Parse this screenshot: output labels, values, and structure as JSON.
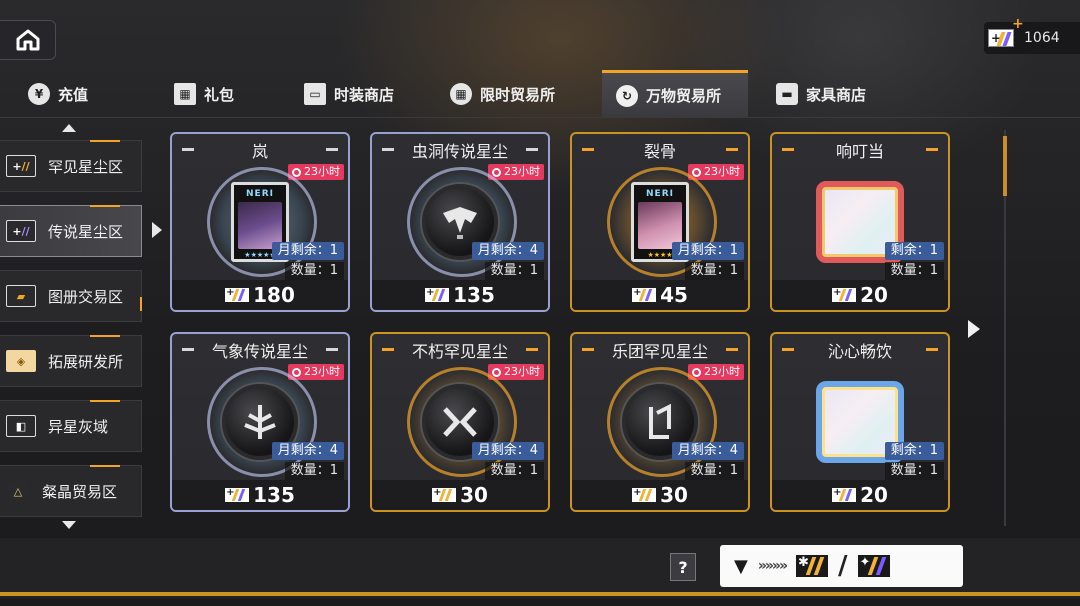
{
  "currency": {
    "amount": "1064",
    "icon": "holo-dust-icon"
  },
  "tabs": [
    {
      "label": "充值",
      "icon": "¥"
    },
    {
      "label": "礼包",
      "icon": "gift"
    },
    {
      "label": "时装商店",
      "icon": "card"
    },
    {
      "label": "限时贸易所",
      "icon": "grid"
    },
    {
      "label": "万物贸易所",
      "icon": "cycle",
      "active": true
    },
    {
      "label": "家具商店",
      "icon": "sofa"
    }
  ],
  "sidebar": {
    "items": [
      {
        "label": "罕见星尘区"
      },
      {
        "label": "传说星尘区",
        "active": true
      },
      {
        "label": "图册交易区"
      },
      {
        "label": "拓展研发所"
      },
      {
        "label": "异星灰域"
      },
      {
        "label": "粲晶贸易区"
      }
    ]
  },
  "cards": [
    {
      "title": "岚",
      "timer": "23小时",
      "remain": "月剩余：1",
      "qty": "数量：1",
      "price": "180",
      "style": "holo",
      "item": "portrait-dark"
    },
    {
      "title": "虫洞传说星尘",
      "timer": "23小时",
      "remain": "月剩余：4",
      "qty": "数量：1",
      "price": "135",
      "style": "holo",
      "item": "dust"
    },
    {
      "title": "裂骨",
      "timer": "23小时",
      "remain": "月剩余：1",
      "qty": "数量：1",
      "price": "45",
      "style": "gold",
      "item": "portrait-pink"
    },
    {
      "title": "响叮当",
      "timer": "",
      "remain": "剩余：1",
      "qty": "数量：1",
      "price": "20",
      "style": "gold",
      "item": "frame-red"
    },
    {
      "title": "气象传说星尘",
      "timer": "23小时",
      "remain": "月剩余：4",
      "qty": "数量：1",
      "price": "135",
      "style": "holo",
      "item": "dust"
    },
    {
      "title": "不朽罕见星尘",
      "timer": "23小时",
      "remain": "月剩余：4",
      "qty": "数量：1",
      "price": "30",
      "style": "gold",
      "item": "dust"
    },
    {
      "title": "乐团罕见星尘",
      "timer": "23小时",
      "remain": "月剩余：4",
      "qty": "数量：1",
      "price": "30",
      "style": "gold",
      "item": "dust"
    },
    {
      "title": "沁心畅饮",
      "timer": "",
      "remain": "剩余：1",
      "qty": "数量：1",
      "price": "20",
      "style": "gold",
      "item": "frame-blue"
    }
  ],
  "bottom": {
    "help_label": "?"
  }
}
